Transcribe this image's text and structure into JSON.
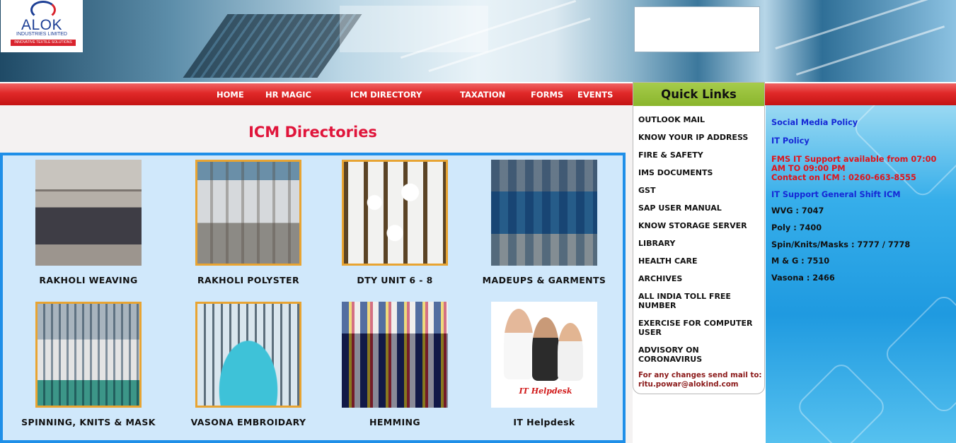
{
  "header": {
    "logo": {
      "name": "ALOK",
      "subtitle": "INDUSTRIES LIMITED",
      "tagline": "INNOVATIVE TEXTILE SOLUTIONS"
    }
  },
  "nav": [
    {
      "label": "HOME"
    },
    {
      "label": "HR MAGIC"
    },
    {
      "label": "ICM DIRECTORY"
    },
    {
      "label": "TAXATION"
    },
    {
      "label": "FORMS"
    },
    {
      "label": "EVENTS"
    }
  ],
  "main": {
    "title": "ICM Directories",
    "tiles": [
      {
        "label": "RAKHOLI WEAVING"
      },
      {
        "label": "RAKHOLI POLYSTER"
      },
      {
        "label": "DTY UNIT 6 - 8"
      },
      {
        "label": "MADEUPS & GARMENTS"
      },
      {
        "label": "SPINNING, KNITS & MASK"
      },
      {
        "label": "VASONA EMBROIDARY"
      },
      {
        "label": "HEMMING"
      },
      {
        "label": "IT Helpdesk",
        "image_caption": "IT Helpdesk"
      }
    ]
  },
  "quick_links": {
    "title": "Quick Links",
    "items": [
      "OUTLOOK MAIL",
      "KNOW YOUR IP ADDRESS",
      "FIRE & SAFETY",
      "IMS DOCUMENTS",
      "GST",
      "SAP USER MANUAL",
      "KNOW STORAGE SERVER",
      "LIBRARY",
      "HEALTH CARE",
      "ARCHIVES",
      "ALL INDIA TOLL FREE NUMBER",
      "EXERCISE FOR COMPUTER USER",
      "ADVISORY ON CORONAVIRUS"
    ],
    "note": "For any changes send mail to: ritu.powar@alokind.com"
  },
  "right_panel": {
    "social_media_policy": "Social Media Policy",
    "it_policy": "IT Policy",
    "fms_notice": "FMS IT Support available from 07:00 AM TO 09:00 PM",
    "contact_notice": "Contact on ICM : 0260-663-8555",
    "general_shift": "IT Support General Shift ICM",
    "extensions": [
      "WVG : 7047",
      "Poly : 7400",
      "Spin/Knits/Masks : 7777 / 7778",
      "M & G : 7510",
      "Vasona : 2466"
    ]
  },
  "colors": {
    "nav_red": "#e02828",
    "title_red": "#e0153b",
    "quicklinks_green": "#8ab52c",
    "gallery_border": "#1f8fe8",
    "gallery_bg": "#d0e8fb",
    "link_blue": "#1528d6"
  }
}
